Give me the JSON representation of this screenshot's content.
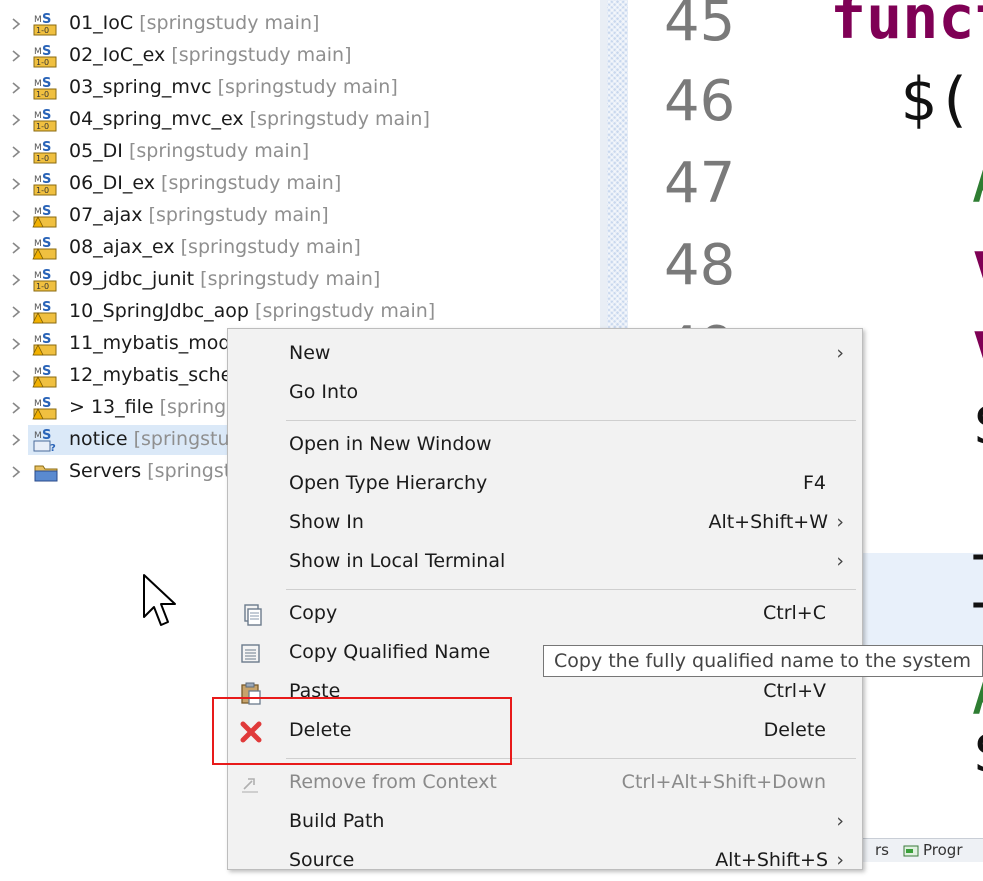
{
  "explorer": {
    "projects": [
      {
        "name": "01_IoC",
        "deco": " [springstudy main]",
        "kind": "spring"
      },
      {
        "name": "02_IoC_ex",
        "deco": " [springstudy main]",
        "kind": "spring"
      },
      {
        "name": "03_spring_mvc",
        "deco": " [springstudy main]",
        "kind": "spring"
      },
      {
        "name": "04_spring_mvc_ex",
        "deco": " [springstudy main]",
        "kind": "spring"
      },
      {
        "name": "05_DI",
        "deco": " [springstudy main]",
        "kind": "spring"
      },
      {
        "name": "06_DI_ex",
        "deco": " [springstudy main]",
        "kind": "spring"
      },
      {
        "name": "07_ajax",
        "deco": " [springstudy main]",
        "kind": "spring-warn"
      },
      {
        "name": "08_ajax_ex",
        "deco": " [springstudy main]",
        "kind": "spring-warn"
      },
      {
        "name": "09_jdbc_junit",
        "deco": " [springstudy main]",
        "kind": "spring"
      },
      {
        "name": "10_SpringJdbc_aop",
        "deco": " [springstudy main]",
        "kind": "spring-warn"
      },
      {
        "name": "11_mybatis_mod",
        "deco": "",
        "kind": "spring-warn"
      },
      {
        "name": "12_mybatis_sche",
        "deco": "",
        "kind": "spring-warn"
      },
      {
        "name": "> 13_file",
        "deco": " [spring",
        "kind": "spring-warn"
      },
      {
        "name": "notice",
        "deco": " [springstu",
        "kind": "spring-q",
        "selected": true
      },
      {
        "name": "Servers",
        "deco": " [springst",
        "kind": "folder"
      }
    ]
  },
  "editor": {
    "line_numbers": [
      "45",
      "46",
      "47",
      "48",
      "49"
    ],
    "code_fragments": {
      "l45": "funct",
      "l46": "$(",
      "l47": "A",
      "l48": "v",
      "l49": "v",
      "l50": "$",
      "l52": "T",
      "l53": "T",
      "l54": "A",
      "l55": "$"
    }
  },
  "context_menu": {
    "items": [
      {
        "label": "New",
        "accel": "",
        "submenu": true
      },
      {
        "label": "Go Into",
        "accel": ""
      },
      {
        "label": "Open in New Window",
        "accel": ""
      },
      {
        "label": "Open Type Hierarchy",
        "accel": "F4"
      },
      {
        "label": "Show In",
        "accel": "Alt+Shift+W",
        "submenu": true
      },
      {
        "label": "Show in Local Terminal",
        "accel": "",
        "submenu": true
      },
      {
        "label": "Copy",
        "accel": "Ctrl+C",
        "icon": "copy-icon"
      },
      {
        "label": "Copy Qualified Name",
        "accel": "",
        "icon": "copy-qualified-name-icon"
      },
      {
        "label": "Paste",
        "accel": "Ctrl+V",
        "icon": "paste-icon"
      },
      {
        "label": "Delete",
        "accel": "Delete",
        "icon": "delete-icon"
      },
      {
        "label": "Remove from Context",
        "accel": "Ctrl+Alt+Shift+Down",
        "icon": "remove-from-context-icon",
        "disabled": true
      },
      {
        "label": "Build Path",
        "accel": "",
        "submenu": true
      },
      {
        "label": "Source",
        "accel": "Alt+Shift+S",
        "submenu": true
      }
    ]
  },
  "tooltip": {
    "text": "Copy the fully qualified name to the system"
  },
  "bottom_tabs": {
    "partial_1": "rs",
    "partial_2": "Progr"
  },
  "colors": {
    "highlight_box": "#e81a1a",
    "selection": "#dbe9f8",
    "menu_bg": "#f2f2f2",
    "keyword_purple": "#7f0055",
    "green_text": "#2e7d32",
    "decoration_gray": "#8f8f8f"
  }
}
